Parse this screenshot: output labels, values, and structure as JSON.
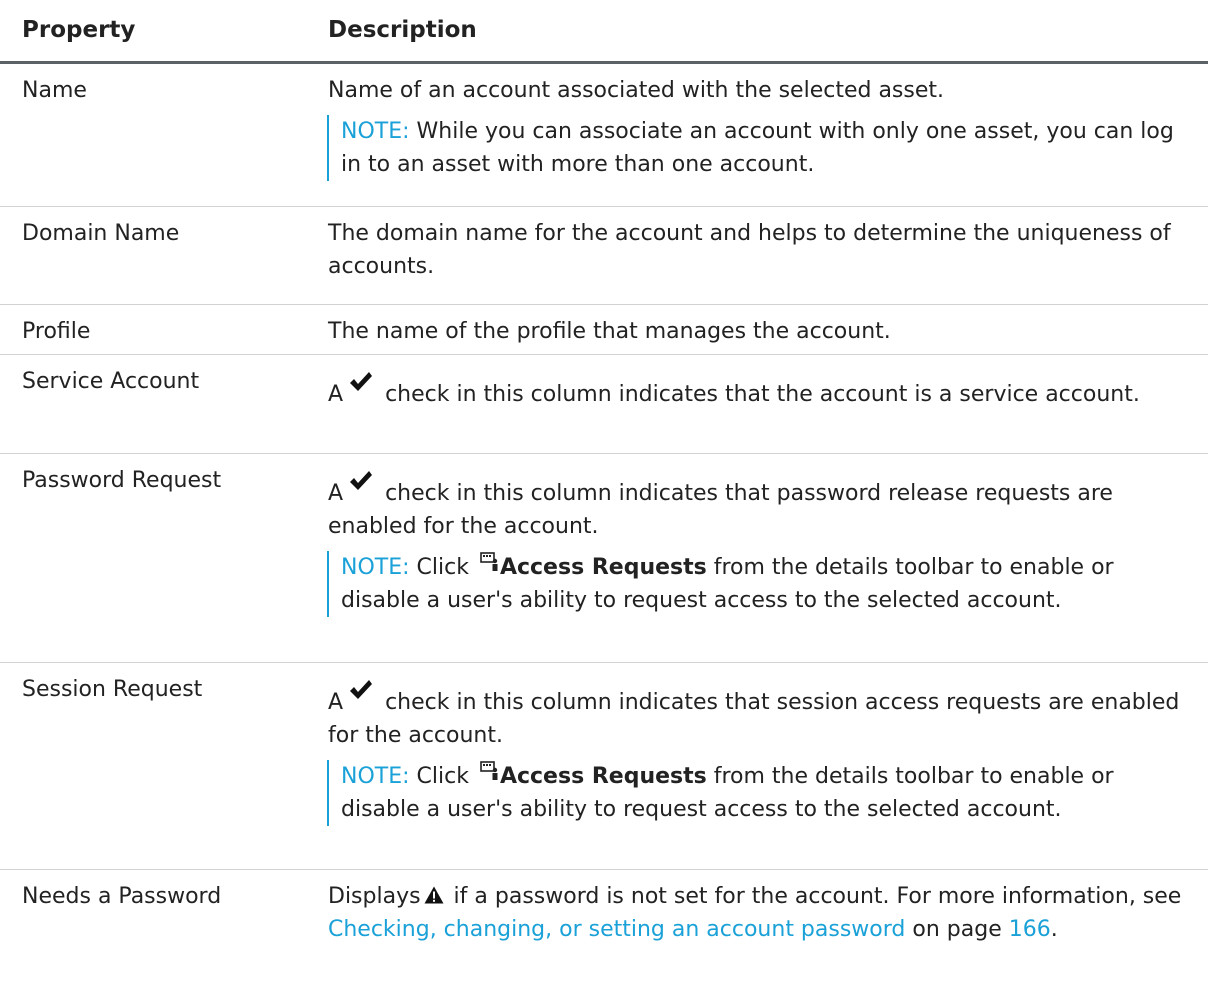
{
  "header": {
    "property": "Property",
    "description": "Description"
  },
  "rows": [
    {
      "property": "Name",
      "description": "Name of an account associated with the selected asset.",
      "note_label": "NOTE:",
      "note_text": " While you can associate an account with only one asset, you can log in to an asset with more than one account."
    },
    {
      "property": "Domain Name",
      "description": "The domain name for the account and helps to determine the uniqueness of accounts."
    },
    {
      "property": "Profile",
      "description": "The name of the profile that manages the account."
    },
    {
      "property": "Service Account",
      "desc_prefix": "A",
      "desc_suffix": "check in this column indicates that the account is a service account."
    },
    {
      "property": "Password Request",
      "desc_prefix": "A",
      "desc_suffix": "check in this column indicates that password release requests are enabled for the account.",
      "note_label": "NOTE:",
      "note_before": " Click ",
      "note_bold": "Access Requests",
      "note_after": " from the details toolbar to enable or disable a user's ability to request access to the selected account."
    },
    {
      "property": "Session Request",
      "desc_prefix": "A",
      "desc_suffix": "check in this column indicates that session access requests are enabled for the account.",
      "note_label": "NOTE:",
      "note_before": " Click ",
      "note_bold": "Access Requests",
      "note_after": " from the details toolbar to enable or disable a user's ability to request access to the selected account."
    },
    {
      "property": "Needs a Password",
      "desc_prefix": "Displays",
      "desc_middle": " if a password is not set for the account. For more information, see ",
      "link_text": "Checking, changing, or setting an account password",
      "desc_between": " on page ",
      "page_link": "166",
      "desc_end": "."
    }
  ],
  "icons": {
    "check": "checkmark-icon",
    "access_requests": "access-requests-icon",
    "warning": "warning-triangle-icon"
  },
  "colors": {
    "accent": "#1aa1d8",
    "text": "#222222",
    "header_rule": "#5a6266"
  }
}
